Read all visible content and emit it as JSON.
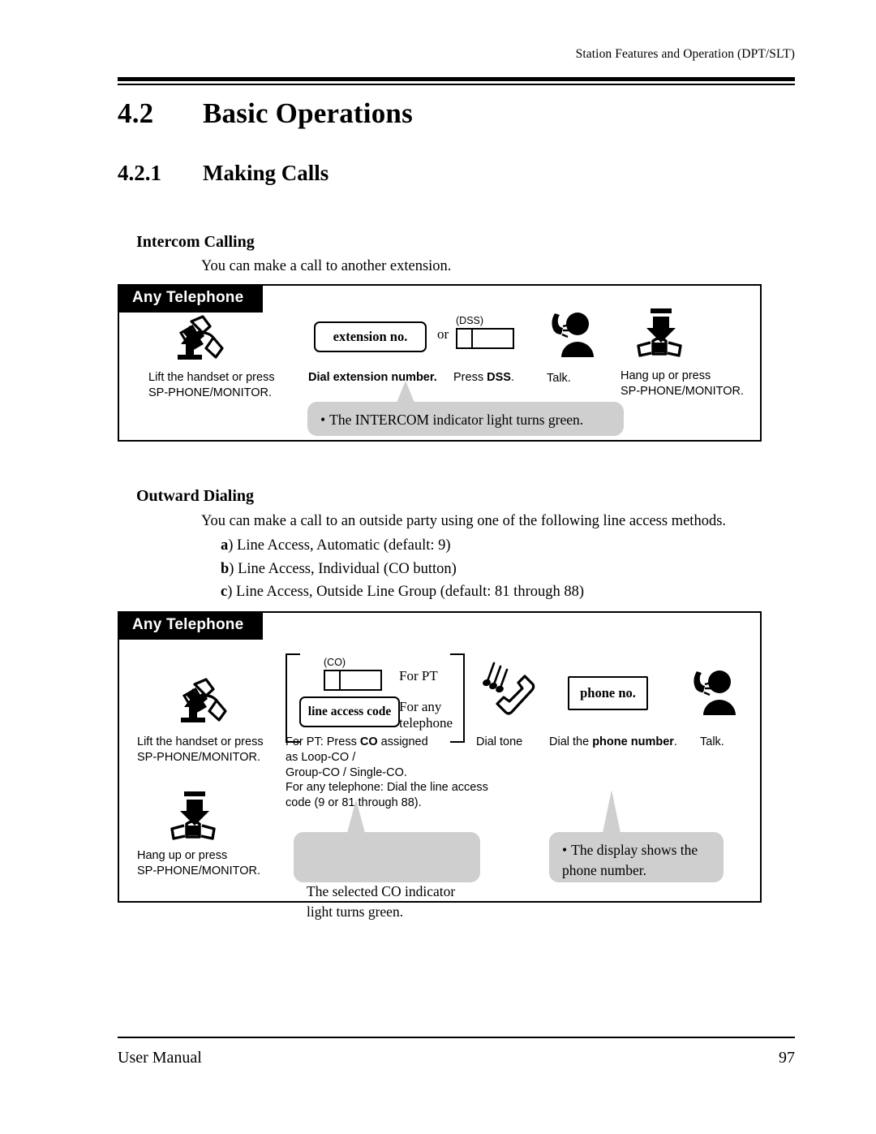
{
  "header": {
    "running_title": "Station Features and Operation (DPT/SLT)"
  },
  "headings": {
    "section_number": "4.2",
    "section_title": "Basic Operations",
    "subsection_number": "4.2.1",
    "subsection_title": "Making Calls"
  },
  "intercom": {
    "topic": "Intercom Calling",
    "intro": "You can make a call to another extension.",
    "box_tab": "Any Telephone",
    "step1_caption": "Lift the handset or press\nSP-PHONE/MONITOR.",
    "key_extension": "extension no.",
    "or": "or",
    "dss_label": "(DSS)",
    "step2_caption_bold": "Dial extension number.",
    "step3_caption_prefix": "Press ",
    "step3_caption_bold": "DSS",
    "step3_caption_suffix": ".",
    "talk_caption": "Talk.",
    "hangup_caption": "Hang up or press\nSP-PHONE/MONITOR.",
    "callout_bullet": "•",
    "callout_text": "The INTERCOM indicator light turns green."
  },
  "outward": {
    "topic": "Outward Dialing",
    "intro": "You can make a call to an outside party using one of the following line access methods.",
    "methods": [
      {
        "letter": "a",
        "paren": ")",
        "text": "Line Access, Automatic (default: 9)"
      },
      {
        "letter": "b",
        "paren": ")",
        "text": "Line Access, Individual (CO button)"
      },
      {
        "letter": "c",
        "paren": ")",
        "text": "Line Access, Outside Line Group (default: 81 through 88)"
      }
    ],
    "box_tab": "Any Telephone",
    "co_label": "(CO)",
    "bracket_note_pt": "For PT",
    "bracket_note_any": "For any\ntelephone",
    "key_line_access_code": "line access code",
    "step1_caption": "Lift the handset or press\nSP-PHONE/MONITOR.",
    "hangup_caption": "Hang up or press\nSP-PHONE/MONITOR.",
    "step2_caption_line1_a": "For PT: Press ",
    "step2_caption_line1_b": "CO",
    "step2_caption_line1_c": " assigned",
    "step2_caption_rest": "        as Loop-CO /\n        Group-CO / Single-CO.\nFor any telephone: Dial the line access\n        code (9 or 81 through 88).",
    "dial_tone_caption": "Dial tone",
    "key_phone_no": "phone no.",
    "step3_caption_prefix": "Dial the ",
    "step3_caption_bold": "phone number",
    "step3_caption_suffix": ".",
    "talk_caption": "Talk.",
    "callout_co": "The selected CO indicator\nlight turns green.",
    "callout_display_bullet": "•",
    "callout_display_text": "The display shows the\nphone number."
  },
  "footer": {
    "left": "User Manual",
    "page_number": "97"
  },
  "colors": {
    "ink": "#000000",
    "callout_gray": "#cfcfcf",
    "paper": "#ffffff"
  }
}
